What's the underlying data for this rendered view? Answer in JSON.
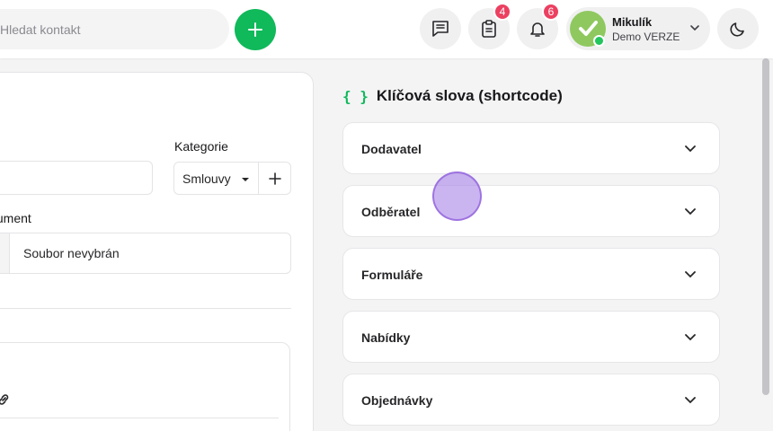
{
  "header": {
    "search_placeholder": "Hledat kontakt",
    "notes_badge": "4",
    "notifications_badge": "6",
    "user": {
      "name": "Mikulík",
      "role": "Demo VERZE"
    }
  },
  "form": {
    "category_label": "Kategorie",
    "category_value": "Smlouvy",
    "document_label": "Dokument",
    "file_status": "Soubor nevybrán"
  },
  "shortcodes": {
    "title": "Klíčová slova (shortcode)",
    "items": [
      {
        "label": "Dodavatel"
      },
      {
        "label": "Odběratel"
      },
      {
        "label": "Formuláře"
      },
      {
        "label": "Nabídky"
      },
      {
        "label": "Objednávky"
      }
    ]
  },
  "colors": {
    "accent": "#10b95a",
    "badge": "#ec4061",
    "avatar": "#8fc85f"
  },
  "icons": {
    "add": "plus-icon",
    "messages": "message-list-icon",
    "notes": "clipboard-icon",
    "notifications": "bell-icon",
    "theme": "moon-icon",
    "accordion": "chevron-down-icon"
  }
}
